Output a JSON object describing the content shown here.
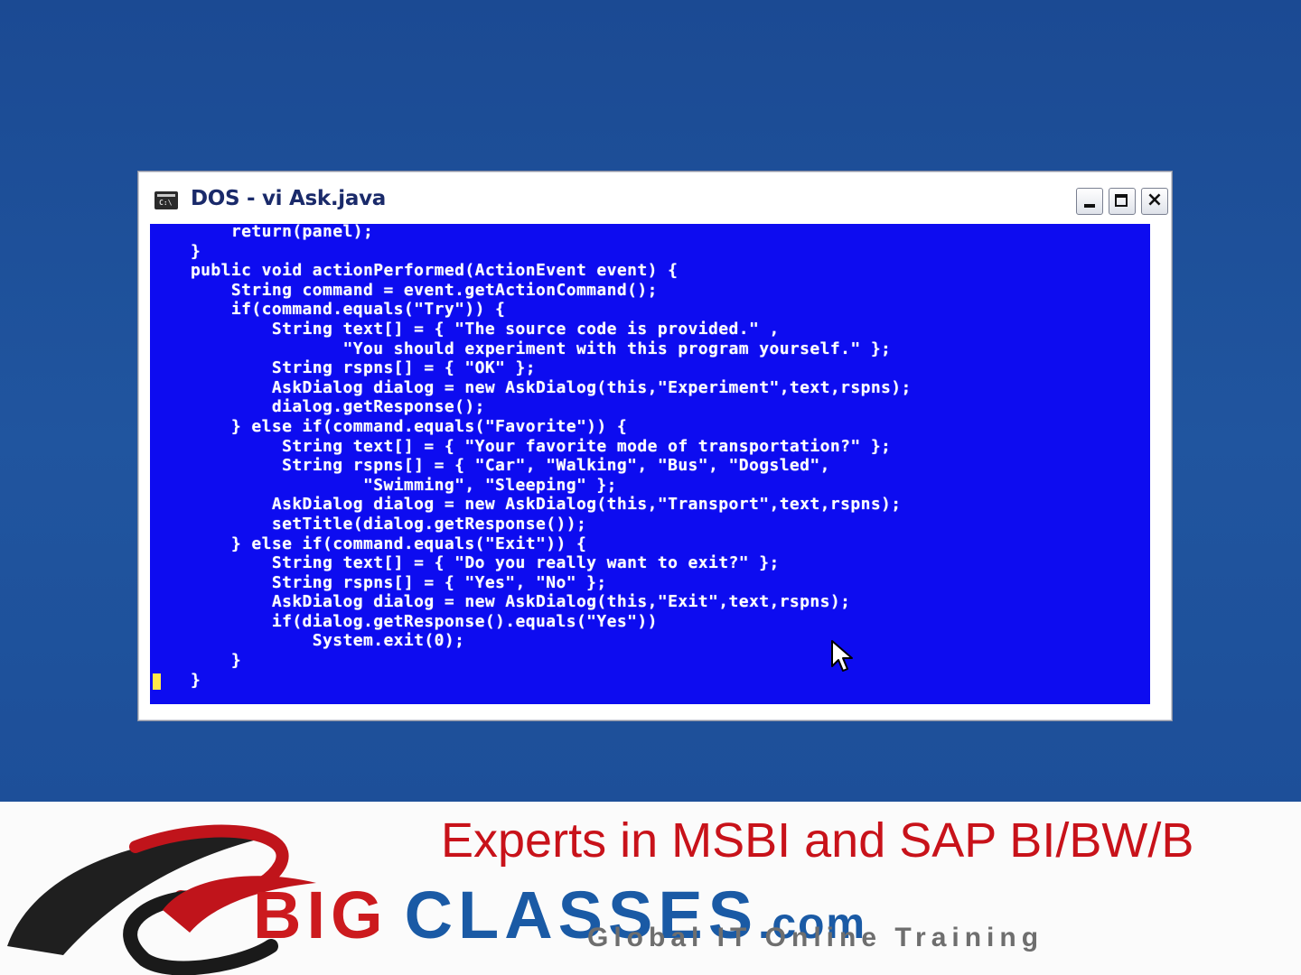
{
  "window": {
    "title": "DOS - vi Ask.java",
    "icon_label": "C:\\",
    "controls": {
      "minimize": "minimize",
      "maximize": "maximize",
      "close": "×"
    }
  },
  "console": {
    "lines": [
      "        return(panel);",
      "    }",
      "    public void actionPerformed(ActionEvent event) {",
      "        String command = event.getActionCommand();",
      "        if(command.equals(\"Try\")) {",
      "            String text[] = { \"The source code is provided.\" ,",
      "                   \"You should experiment with this program yourself.\" };",
      "            String rspns[] = { \"OK\" };",
      "            AskDialog dialog = new AskDialog(this,\"Experiment\",text,rspns);",
      "            dialog.getResponse();",
      "        } else if(command.equals(\"Favorite\")) {",
      "             String text[] = { \"Your favorite mode of transportation?\" };",
      "             String rspns[] = { \"Car\", \"Walking\", \"Bus\", \"Dogsled\",",
      "                     \"Swimming\", \"Sleeping\" };",
      "            AskDialog dialog = new AskDialog(this,\"Transport\",text,rspns);",
      "            setTitle(dialog.getResponse());",
      "        } else if(command.equals(\"Exit\")) {",
      "            String text[] = { \"Do you really want to exit?\" };",
      "            String rspns[] = { \"Yes\", \"No\" };",
      "            AskDialog dialog = new AskDialog(this,\"Exit\",text,rspns);",
      "            if(dialog.getResponse().equals(\"Yes\"))",
      "                System.exit(0);",
      "        }",
      "    }"
    ]
  },
  "banner": {
    "tagline": "Experts in MSBI and SAP BI/BW/B",
    "brand_big": "BIG",
    "brand_classes": "CLASSES",
    "brand_com": ".com",
    "subtitle": "Global IT Online Training"
  },
  "colors": {
    "desktop": "#1f4f98",
    "console_bg": "#0d0cf0",
    "console_text": "#ffffff",
    "cursor": "#ffe84a",
    "tagline": "#c8121a",
    "brand_red": "#cc1a1e",
    "brand_blue": "#1a5aa5"
  }
}
